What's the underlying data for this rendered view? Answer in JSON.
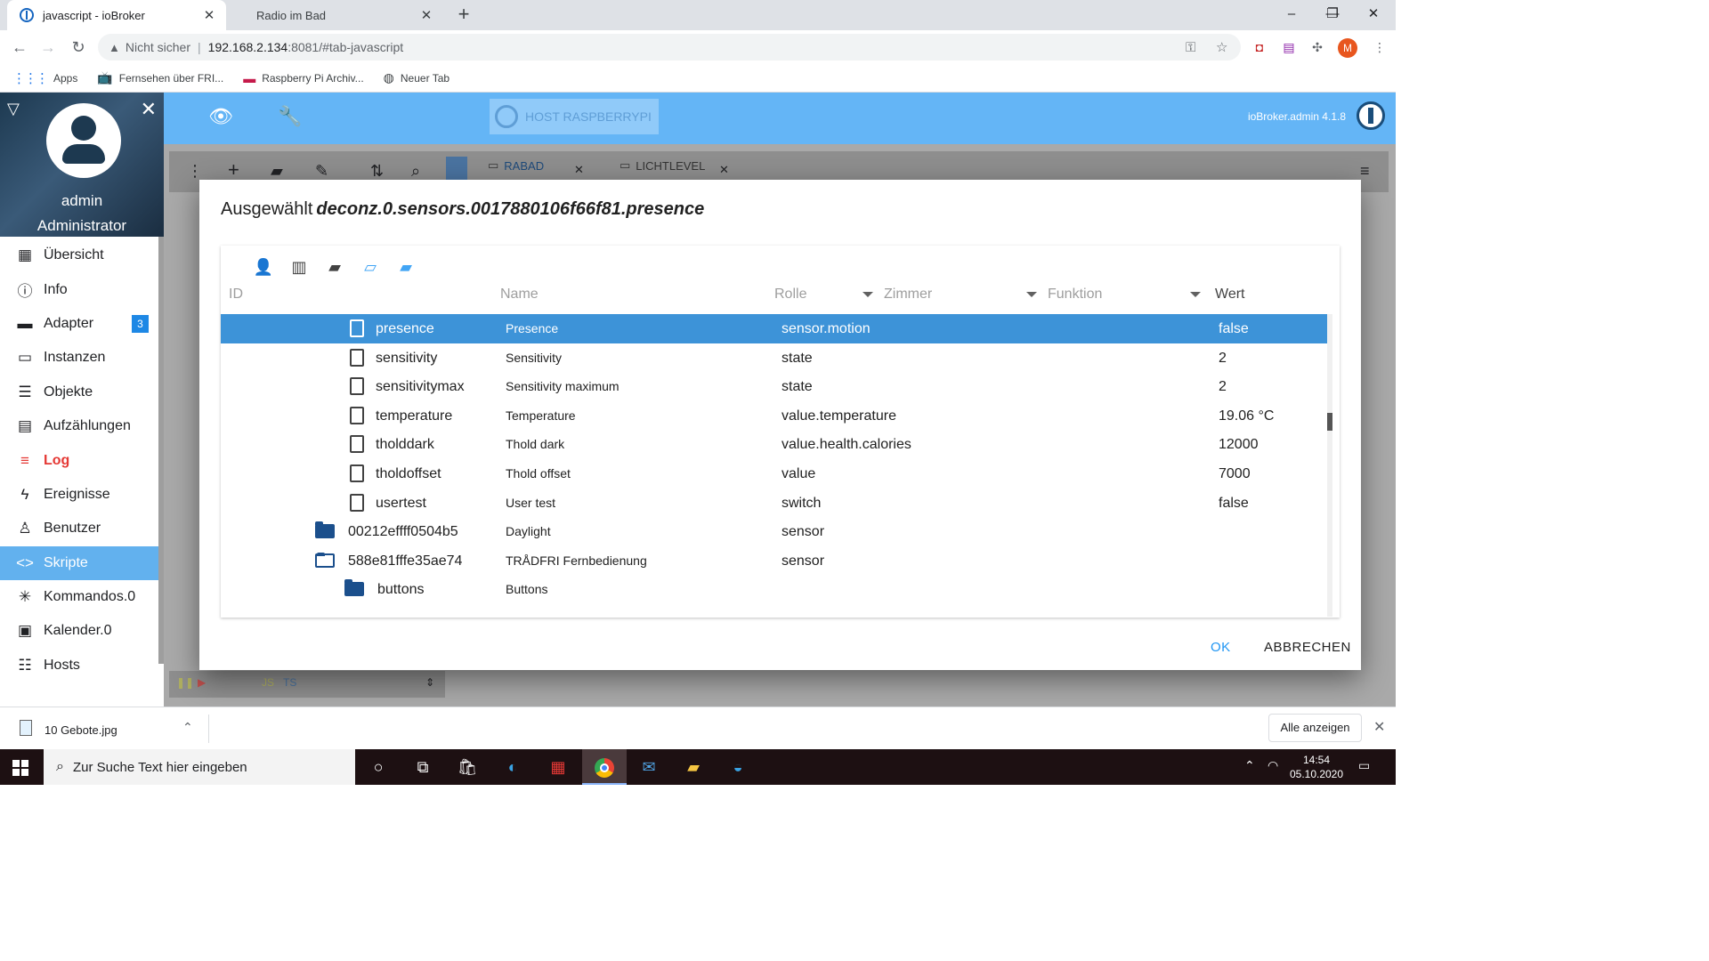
{
  "browser": {
    "tabs": [
      {
        "title": "javascript - ioBroker",
        "active": true
      },
      {
        "title": "Radio im Bad",
        "active": false
      }
    ],
    "address": {
      "security_label": "Nicht sicher",
      "host": "192.168.2.134",
      "path": ":8081/#tab-javascript"
    },
    "profile_initial": "M",
    "bookmarks": [
      {
        "label": "Apps",
        "icon": "apps-grid-icon"
      },
      {
        "label": "Fernsehen über FRI...",
        "icon": "tv-icon"
      },
      {
        "label": "Raspberry Pi Archiv...",
        "icon": "raspberry-icon"
      },
      {
        "label": "Neuer Tab",
        "icon": "globe-icon"
      }
    ]
  },
  "sidebar": {
    "user_name": "admin",
    "user_role": "Administrator",
    "items": [
      {
        "label": "Übersicht",
        "icon": "grid-icon"
      },
      {
        "label": "Info",
        "icon": "info-icon"
      },
      {
        "label": "Adapter",
        "icon": "store-icon",
        "badge": "3"
      },
      {
        "label": "Instanzen",
        "icon": "instances-icon"
      },
      {
        "label": "Objekte",
        "icon": "list-icon"
      },
      {
        "label": "Aufzählungen",
        "icon": "enum-icon"
      },
      {
        "label": "Log",
        "icon": "log-icon"
      },
      {
        "label": "Ereignisse",
        "icon": "bolt-icon"
      },
      {
        "label": "Benutzer",
        "icon": "user-icon"
      },
      {
        "label": "Skripte",
        "icon": "code-icon"
      },
      {
        "label": "Kommandos.0",
        "icon": "asterisk-icon"
      },
      {
        "label": "Kalender.0",
        "icon": "calendar-icon"
      },
      {
        "label": "Hosts",
        "icon": "hosts-icon"
      }
    ]
  },
  "appbar": {
    "host_label": "HOST RASPBERRYPI",
    "version": "ioBroker.admin 4.1.8"
  },
  "script_tabs": [
    "RABAD",
    "LICHTLEVEL"
  ],
  "script_lang_labels": [
    "JS",
    "TS"
  ],
  "dialog": {
    "title_prefix": "Ausgewählt",
    "selected_id": "deconz.0.sensors.0017880106f66f81.presence",
    "columns": {
      "id": "ID",
      "name": "Name",
      "role": "Rolle",
      "room": "Zimmer",
      "function": "Funktion",
      "value": "Wert"
    },
    "rows": [
      {
        "id": "presence",
        "name": "Presence",
        "role": "sensor.motion",
        "value": "false",
        "type": "file"
      },
      {
        "id": "sensitivity",
        "name": "Sensitivity",
        "role": "state",
        "value": "2",
        "type": "file"
      },
      {
        "id": "sensitivitymax",
        "name": "Sensitivity maximum",
        "role": "state",
        "value": "2",
        "type": "file"
      },
      {
        "id": "temperature",
        "name": "Temperature",
        "role": "value.temperature",
        "value": "19.06 °C",
        "type": "file"
      },
      {
        "id": "tholddark",
        "name": "Thold dark",
        "role": "value.health.calories",
        "value": "12000",
        "type": "file"
      },
      {
        "id": "tholdoffset",
        "name": "Thold offset",
        "role": "value",
        "value": "7000",
        "type": "file"
      },
      {
        "id": "usertest",
        "name": "User test",
        "role": "switch",
        "value": "false",
        "type": "file"
      },
      {
        "id": "00212effff0504b5",
        "name": "Daylight",
        "role": "sensor",
        "value": "",
        "type": "folder"
      },
      {
        "id": "588e81fffe35ae74",
        "name": "TRÅDFRI Fernbedienung",
        "role": "sensor",
        "value": "",
        "type": "folder-open"
      },
      {
        "id": "buttons",
        "name": "Buttons",
        "role": "",
        "value": "",
        "type": "folder"
      }
    ],
    "ok_label": "OK",
    "cancel_label": "ABBRECHEN"
  },
  "download_shelf": {
    "file_name": "10 Gebote.jpg",
    "show_all_label": "Alle anzeigen"
  },
  "taskbar": {
    "search_placeholder": "Zur Suche Text hier eingeben",
    "time": "14:54",
    "date": "05.10.2020"
  },
  "colors": {
    "appbar": "#64b5f6",
    "selected_row": "#3d93d8",
    "selected_menu": "#62b1ee",
    "log_red": "#e53935",
    "ok_blue": "#2196f3"
  }
}
